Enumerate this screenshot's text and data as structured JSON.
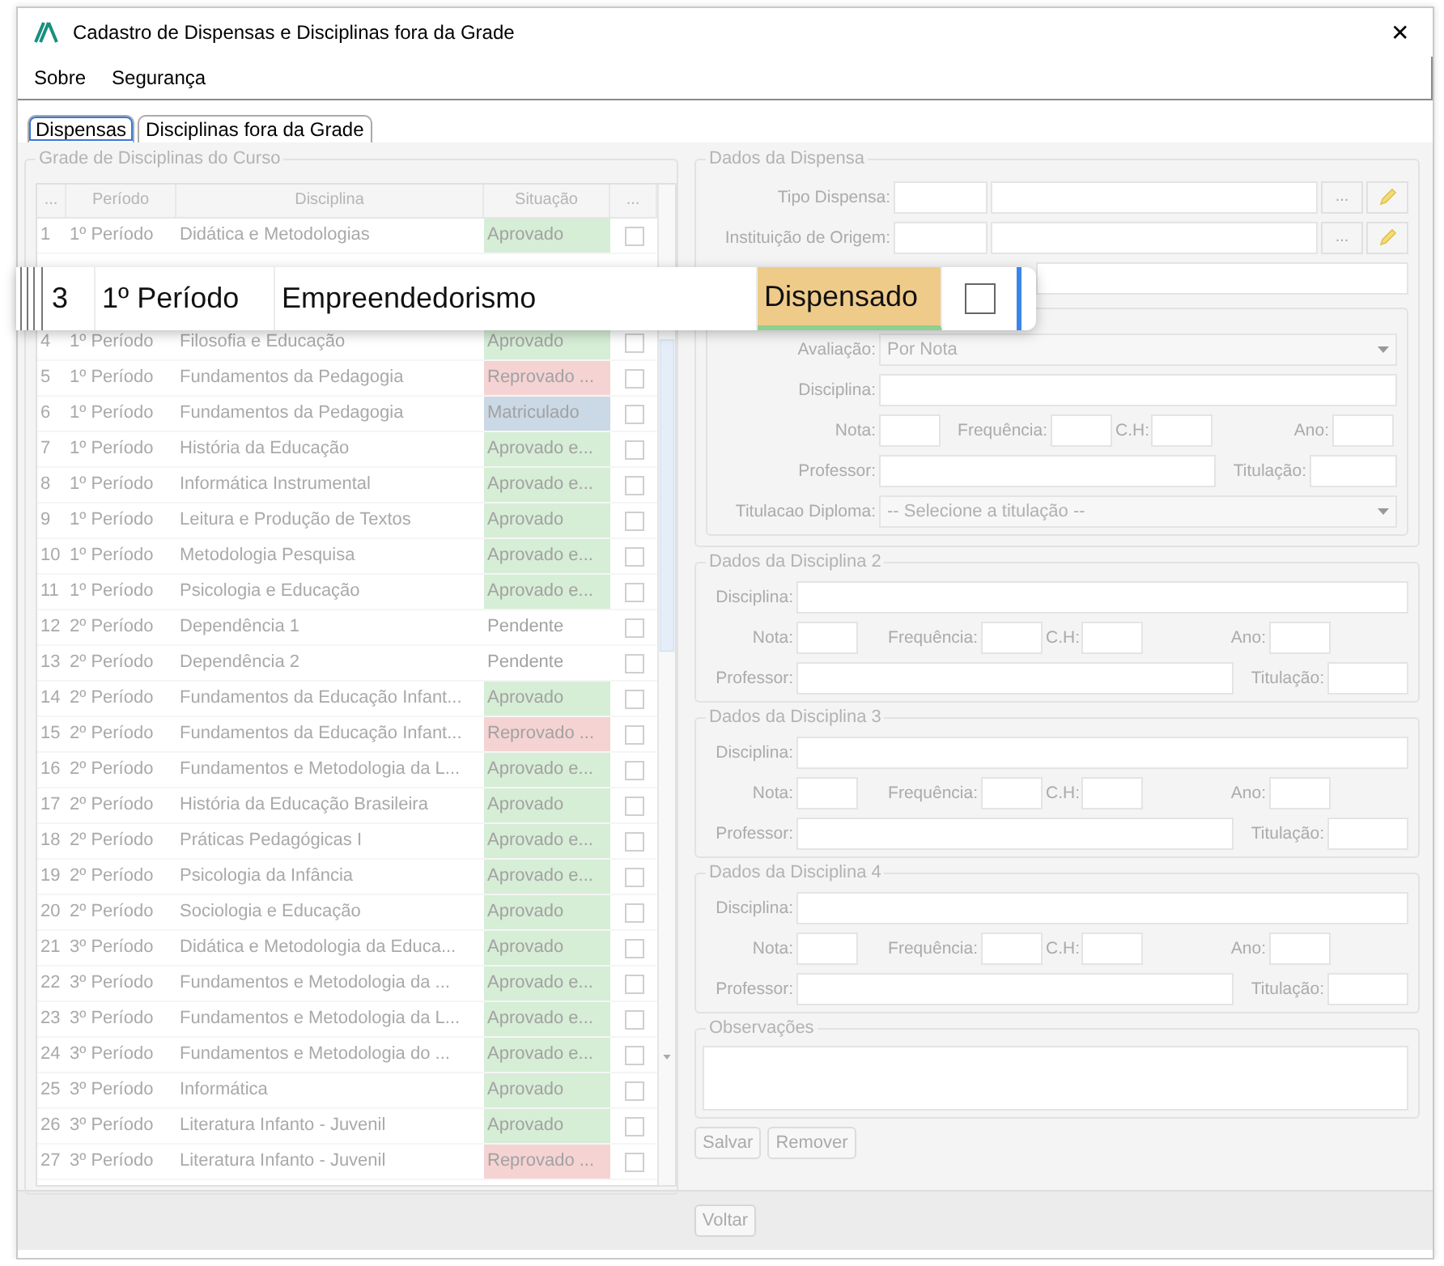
{
  "window": {
    "title": "Cadastro de Dispensas e Disciplinas fora da Grade",
    "close": "✕"
  },
  "menu": [
    {
      "label": "Sobre"
    },
    {
      "label": "Segurança"
    }
  ],
  "tabs": [
    {
      "label": "Dispensas",
      "selected": true
    },
    {
      "label": "Disciplinas fora da Grade",
      "selected": false
    }
  ],
  "grid": {
    "title": "Grade de Disciplinas do Curso",
    "columns": [
      "...",
      "Período",
      "Disciplina",
      "Situação",
      "..."
    ],
    "rows": [
      {
        "number": "1",
        "period": "1º Período",
        "discipline": "Didática e Metodologias",
        "status": "Aprovado",
        "kind": "approved",
        "checked": false
      },
      {
        "number": "4",
        "period": "1º Período",
        "discipline": "Filosofia e Educação",
        "status": "Aprovado",
        "kind": "approved",
        "checked": false
      },
      {
        "number": "5",
        "period": "1º Período",
        "discipline": "Fundamentos da Pedagogia",
        "status": "Reprovado ...",
        "kind": "failed",
        "checked": false
      },
      {
        "number": "6",
        "period": "1º Período",
        "discipline": "Fundamentos da Pedagogia",
        "status": "Matriculado",
        "kind": "enrolled",
        "checked": false
      },
      {
        "number": "7",
        "period": "1º Período",
        "discipline": "História da Educação",
        "status": "Aprovado e...",
        "kind": "approved",
        "checked": false
      },
      {
        "number": "8",
        "period": "1º Período",
        "discipline": "Informática Instrumental",
        "status": "Aprovado e...",
        "kind": "approved",
        "checked": false
      },
      {
        "number": "9",
        "period": "1º Período",
        "discipline": "Leitura e Produção de Textos",
        "status": "Aprovado",
        "kind": "approved",
        "checked": false
      },
      {
        "number": "10",
        "period": "1º Período",
        "discipline": "Metodologia Pesquisa",
        "status": "Aprovado e...",
        "kind": "approved",
        "checked": false
      },
      {
        "number": "11",
        "period": "1º Período",
        "discipline": "Psicologia e Educação",
        "status": "Aprovado e...",
        "kind": "approved",
        "checked": false
      },
      {
        "number": "12",
        "period": "2º Período",
        "discipline": "Dependência 1",
        "status": "Pendente",
        "kind": "pending",
        "checked": false
      },
      {
        "number": "13",
        "period": "2º Período",
        "discipline": "Dependência 2",
        "status": "Pendente",
        "kind": "pending",
        "checked": false
      },
      {
        "number": "14",
        "period": "2º Período",
        "discipline": "Fundamentos da Educação Infant...",
        "status": "Aprovado",
        "kind": "approved",
        "checked": false
      },
      {
        "number": "15",
        "period": "2º Período",
        "discipline": "Fundamentos da Educação Infant...",
        "status": "Reprovado ...",
        "kind": "failed",
        "checked": false
      },
      {
        "number": "16",
        "period": "2º Período",
        "discipline": "Fundamentos e Metodologia da L...",
        "status": "Aprovado e...",
        "kind": "approved",
        "checked": false
      },
      {
        "number": "17",
        "period": "2º Período",
        "discipline": "História da Educação Brasileira",
        "status": "Aprovado",
        "kind": "approved",
        "checked": false
      },
      {
        "number": "18",
        "period": "2º Período",
        "discipline": "Práticas Pedagógicas I",
        "status": "Aprovado e...",
        "kind": "approved",
        "checked": false
      },
      {
        "number": "19",
        "period": "2º Período",
        "discipline": "Psicologia da Infância",
        "status": "Aprovado e...",
        "kind": "approved",
        "checked": false
      },
      {
        "number": "20",
        "period": "2º Período",
        "discipline": "Sociologia e Educação",
        "status": "Aprovado",
        "kind": "approved",
        "checked": false
      },
      {
        "number": "21",
        "period": "3º Período",
        "discipline": "Didática e Metodologia da Educa...",
        "status": "Aprovado",
        "kind": "approved",
        "checked": false
      },
      {
        "number": "22",
        "period": "3º Período",
        "discipline": "Fundamentos e Metodologia da ...",
        "status": "Aprovado e...",
        "kind": "approved",
        "checked": false
      },
      {
        "number": "23",
        "period": "3º Período",
        "discipline": "Fundamentos e Metodologia da L...",
        "status": "Aprovado e...",
        "kind": "approved",
        "checked": false
      },
      {
        "number": "24",
        "period": "3º Período",
        "discipline": "Fundamentos e Metodologia do ...",
        "status": "Aprovado e...",
        "kind": "approved",
        "checked": false
      },
      {
        "number": "25",
        "period": "3º Período",
        "discipline": "Informática",
        "status": "Aprovado",
        "kind": "approved",
        "checked": false
      },
      {
        "number": "26",
        "period": "3º Período",
        "discipline": "Literatura Infanto - Juvenil",
        "status": "Aprovado",
        "kind": "approved",
        "checked": false
      },
      {
        "number": "27",
        "period": "3º Período",
        "discipline": "Literatura Infanto - Juvenil",
        "status": "Reprovado ...",
        "kind": "failed",
        "checked": false
      }
    ]
  },
  "zoomed_row": {
    "number": "3",
    "period": "1º Período",
    "discipline": "Empreendedorismo",
    "status": "Dispensado",
    "kind": "exempt",
    "checked": false
  },
  "dispensa": {
    "title": "Dados da Dispensa",
    "fields": [
      {
        "label": "Tipo Dispensa:",
        "lookup": "..."
      },
      {
        "label": "Instituição de Origem:",
        "lookup": "..."
      }
    ]
  },
  "discipline_groups": [
    {
      "evaluation": {
        "label": "Avaliação:",
        "value": "Por Nota"
      },
      "discipline": "Disciplina:",
      "grade": "Nota:",
      "frequency": "Frequência:",
      "hours": "C.H:",
      "year": "Ano:",
      "teacher": "Professor:",
      "degree": "Titulação:",
      "diploma": {
        "label": "Titulacao Diploma:",
        "value": "-- Selecione a titulação --"
      }
    },
    {
      "title": "Dados da Disciplina 2",
      "discipline": "Disciplina:",
      "grade": "Nota:",
      "frequency": "Frequência:",
      "hours": "C.H:",
      "year": "Ano:",
      "teacher": "Professor:",
      "degree": "Titulação:"
    },
    {
      "title": "Dados da Disciplina 3",
      "discipline": "Disciplina:",
      "grade": "Nota:",
      "frequency": "Frequência:",
      "hours": "C.H:",
      "year": "Ano:",
      "teacher": "Professor:",
      "degree": "Titulação:"
    },
    {
      "title": "Dados da Disciplina 4",
      "discipline": "Disciplina:",
      "grade": "Nota:",
      "frequency": "Frequência:",
      "hours": "C.H:",
      "year": "Ano:",
      "teacher": "Professor:",
      "degree": "Titulação:"
    }
  ],
  "observations": {
    "title": "Observações"
  },
  "form_buttons": [
    "Salvar",
    "Remover"
  ],
  "footer_button": "Voltar"
}
